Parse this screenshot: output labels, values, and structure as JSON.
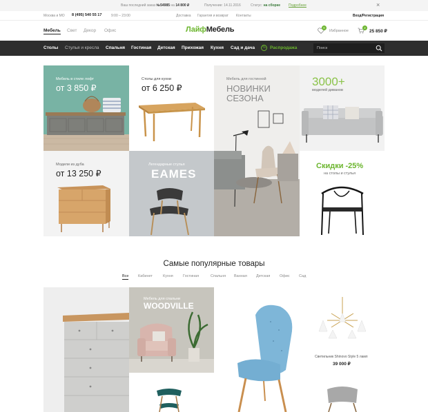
{
  "topbar": {
    "last_order_prefix": "Ваш последний заказ",
    "order_number": "№54985",
    "order_amount_prefix": "на",
    "order_amount": "14 800 ₽",
    "delivery_label": "Получение:",
    "delivery_date": "14.11.2016",
    "status_label": "Статус:",
    "status_value": "на сборке",
    "details_link": "Подробнее",
    "close_glyph": "×"
  },
  "contacts": {
    "region": "Москва и МО",
    "phone": "8 (495) 540 55 17",
    "hours": "9:00 – 23:00",
    "links": [
      "Доставка",
      "Гарантия и возврат",
      "Контакты"
    ],
    "login": "Вход/Регистрация"
  },
  "header": {
    "category_tabs": [
      "Мебель",
      "Свет",
      "Декор",
      "Офис"
    ],
    "logo_part1": "Лайф",
    "logo_part2": "Мебель",
    "favorites_count": "0",
    "favorites_label": "Избранное",
    "cart_count": "2",
    "cart_total": "25 850 ₽"
  },
  "nav": {
    "items": [
      "Столы",
      "Стулья и кресла",
      "Спальня",
      "Гостиная",
      "Детская",
      "Прихожая",
      "Кухня",
      "Сад и дача"
    ],
    "sale": "Распродажа",
    "search_placeholder": "Поиск"
  },
  "promos": {
    "loft_caption": "Мебель в стиле лофт",
    "loft_price": "от 3 850 ₽",
    "kitchen_caption": "Столы для кухни",
    "kitchen_price": "от 6 250 ₽",
    "living_caption": "Мебель для гостинной",
    "living_line1": "НОВИНКИ",
    "living_line2": "СЕЗОНА",
    "sofas_count": "3000+",
    "sofas_caption": "моделей диванов",
    "oak_caption": "Модели из дуба",
    "oak_price": "от 13 250 ₽",
    "eames_caption": "Легендарные стулья",
    "eames_title": "EAMES",
    "discount_title": "Скидки -25%",
    "discount_caption": "на столы и стулья"
  },
  "popular": {
    "title": "Самые популярные товары",
    "filters": [
      "Все",
      "Кабинет",
      "Кухня",
      "Гостиная",
      "Спальня",
      "Ванная",
      "Детская",
      "Офис",
      "Сад"
    ],
    "woodville_caption": "Мебель для спальни",
    "woodville_title": "WOODVILLE",
    "lamp_name": "Светильник Shinovo Style 5 ламп",
    "lamp_price": "39 000 ₽"
  },
  "colors": {
    "accent": "#6bb52d",
    "navbar": "#2e2e2e",
    "gray_tile": "#f2f2f2"
  }
}
